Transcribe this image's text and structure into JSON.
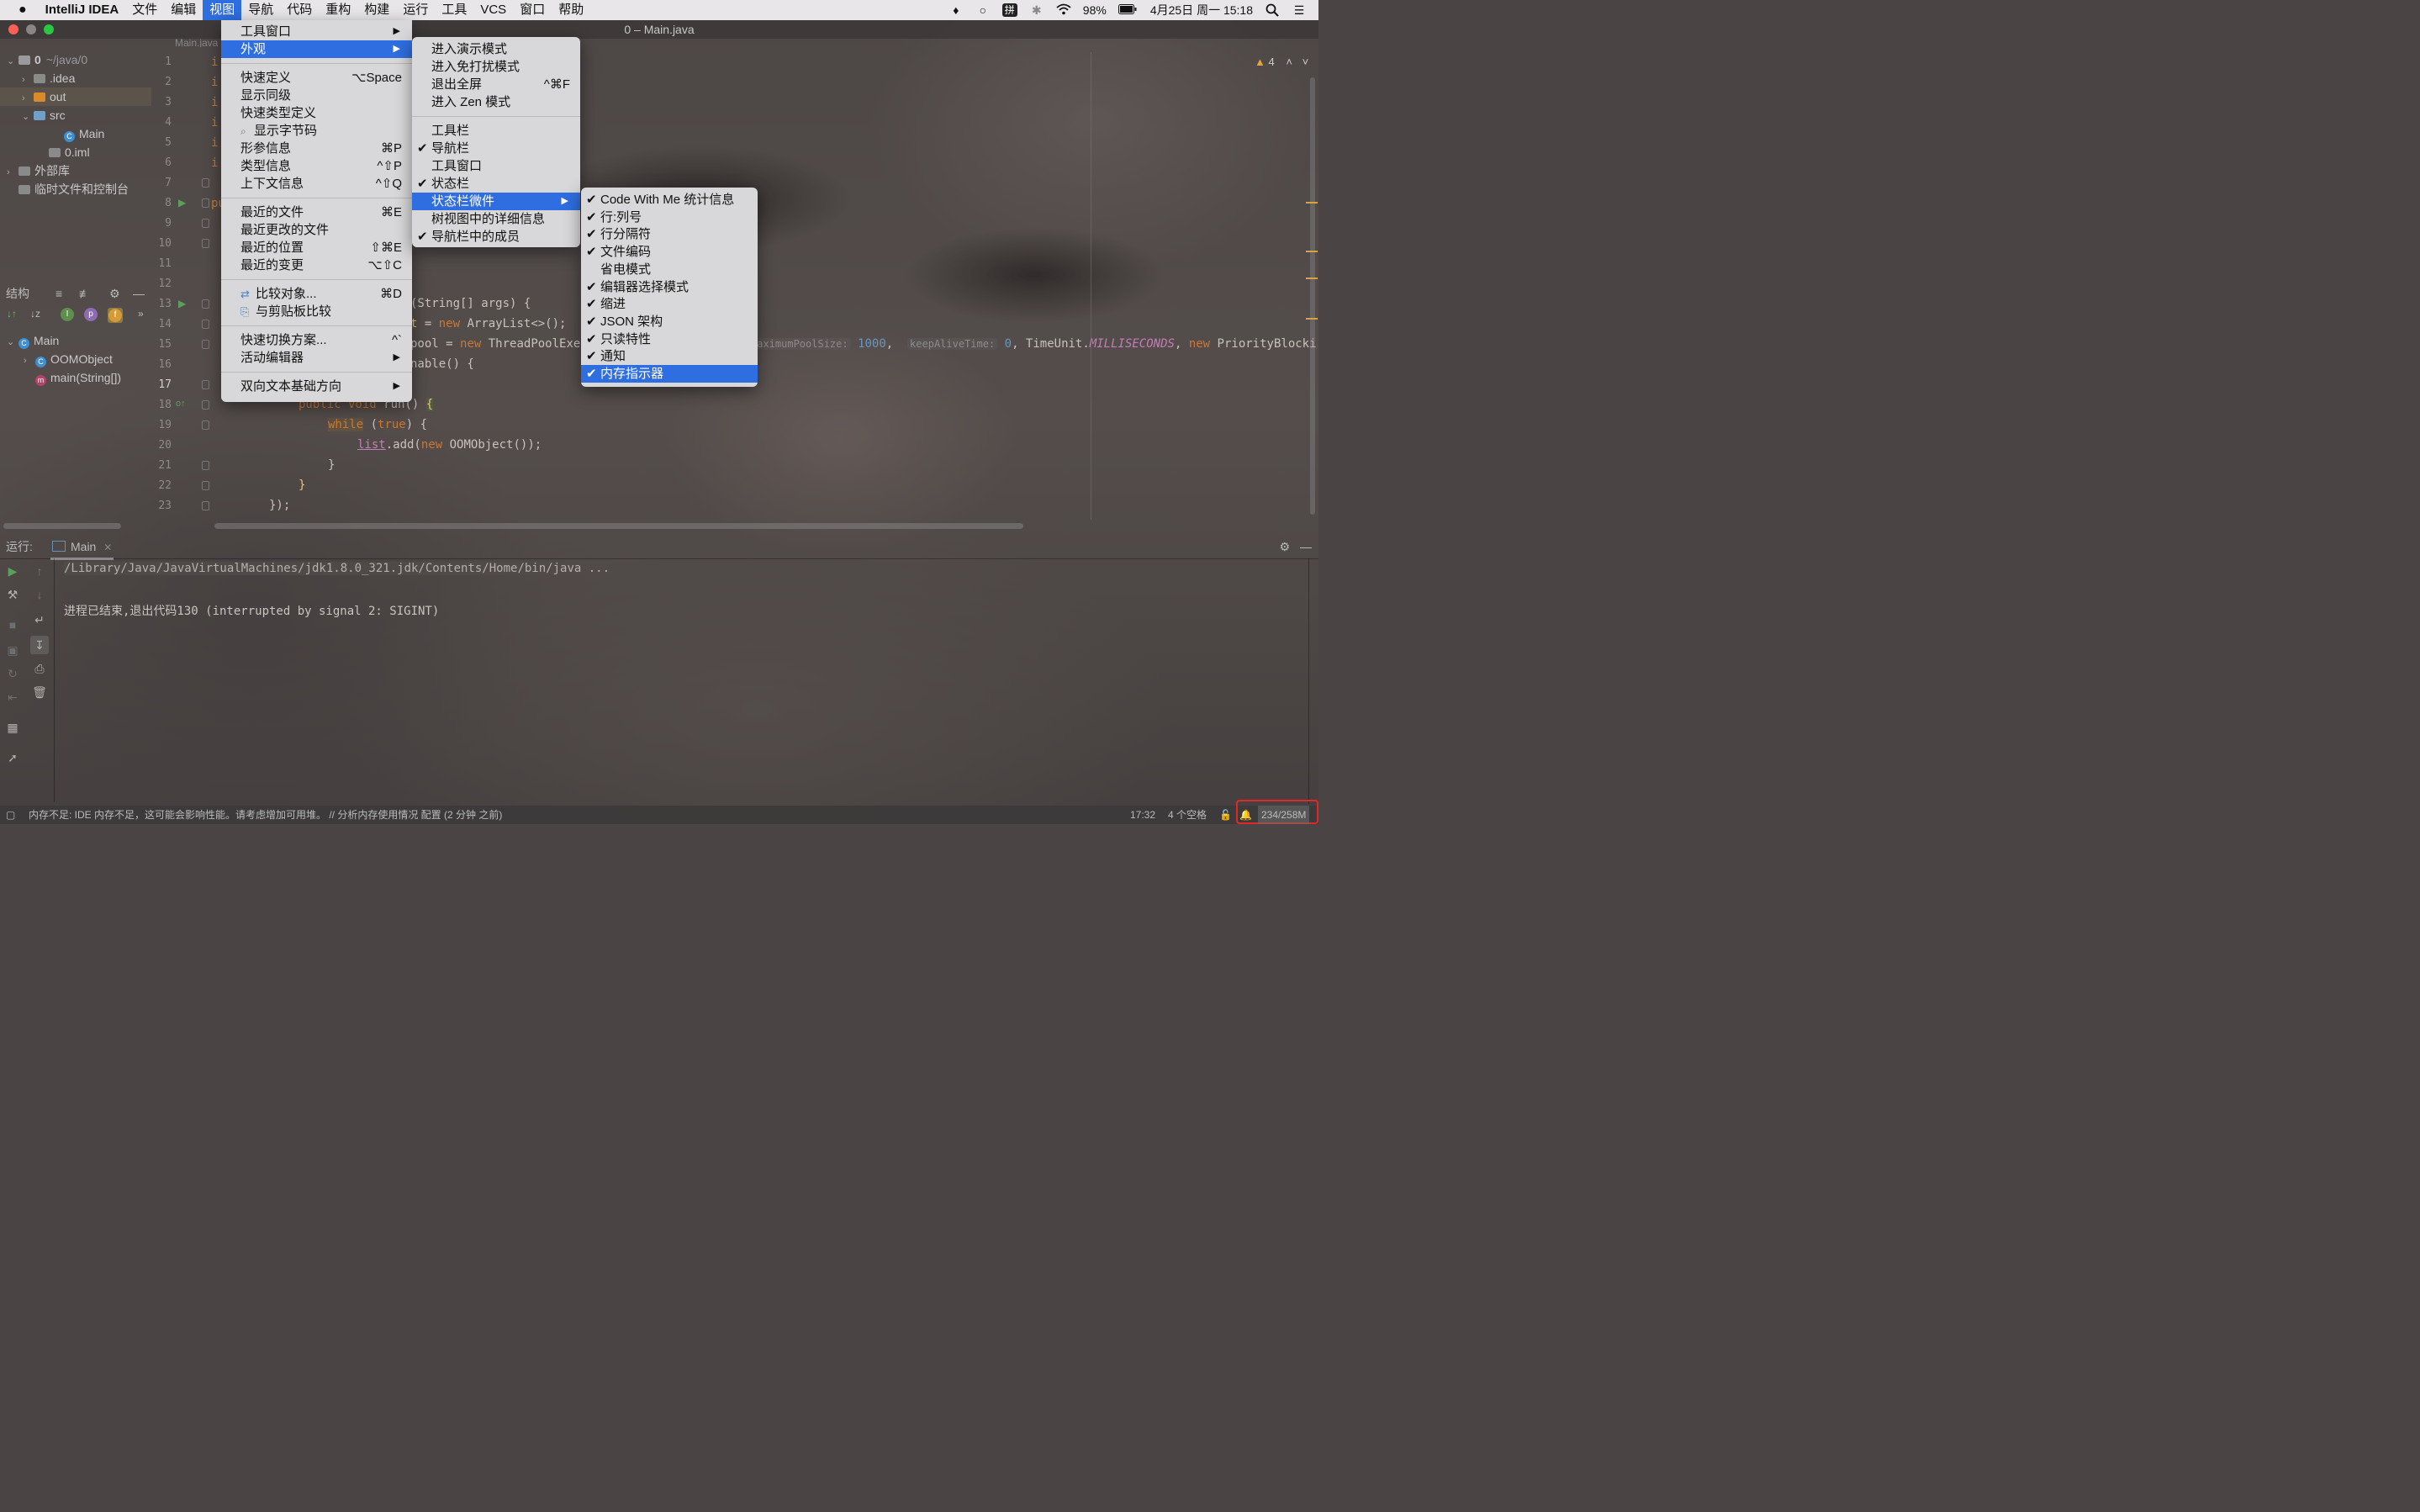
{
  "os_menubar": {
    "app_name": "IntelliJ IDEA",
    "items": [
      "文件",
      "编辑",
      "视图",
      "导航",
      "代码",
      "重构",
      "构建",
      "运行",
      "工具",
      "VCS",
      "窗口",
      "帮助"
    ],
    "active_index": 2,
    "battery": "98%",
    "datetime": "4月25日 周一  15:18",
    "input_method": "拼"
  },
  "window": {
    "title": "0 – Main.java",
    "tab_label": "Main.java"
  },
  "project_tree": [
    {
      "label": "0",
      "suffix": "~/java/0",
      "indent": 0,
      "arrow": "v",
      "icon": "folder-icon"
    },
    {
      "label": ".idea",
      "indent": 1,
      "arrow": ">",
      "icon": "folder-icon"
    },
    {
      "label": "out",
      "indent": 1,
      "arrow": ">",
      "icon": "folder-icon"
    },
    {
      "label": "src",
      "indent": 1,
      "arrow": "v",
      "icon": "folder-icon"
    },
    {
      "label": "Main",
      "indent": 3,
      "arrow": "",
      "icon": "class-icon"
    },
    {
      "label": "0.iml",
      "indent": 2,
      "arrow": "",
      "icon": "file-icon"
    },
    {
      "label": "外部库",
      "indent": 0,
      "arrow": ">",
      "icon": "library-icon"
    },
    {
      "label": "临时文件和控制台",
      "indent": 0,
      "arrow": "",
      "icon": "scratch-icon"
    }
  ],
  "structure": {
    "title": "结构",
    "items": [
      {
        "label": "Main",
        "indent": 0
      },
      {
        "label": "OOMObject",
        "indent": 1
      },
      {
        "label": "main(String[])",
        "indent": 1
      }
    ]
  },
  "editor": {
    "line_numbers": [
      "1",
      "2",
      "3",
      "4",
      "5",
      "6",
      "7",
      "8",
      "9",
      "10",
      "11",
      "12",
      "13",
      "14",
      "15",
      "16",
      "17",
      "18",
      "19",
      "20",
      "21",
      "22",
      "23"
    ],
    "warnings": "4",
    "lines": {
      "l12": "(String[] args) {",
      "l13a": "t",
      "l13b": " = ",
      "l13c": "new",
      "l13d": " ArrayList<>();",
      "l14a": "pool = ",
      "l14b": "new",
      "l14c": " ThreadPoolExe",
      "l14_hint1": "maximumPoolSize:",
      "l14_v1": "1000",
      "l14_hint2": "keepAliveTime:",
      "l14_v2": "0",
      "l14_rest1": ", TimeUnit.",
      "l14_rest2": "MILLISECONDS",
      "l14_rest3": ", ",
      "l14_rest4": "new",
      "l14_rest5": " PriorityBlocki",
      "l15": "nable() {",
      "l17a": "public void",
      "l17b": " run() ",
      "l17c": "{",
      "l18a": "while",
      "l18b": " (",
      "l18c": "true",
      "l18d": ") {",
      "l19a": "list",
      "l19b": ".add(",
      "l19c": "new",
      "l19d": " OOMObject());",
      "l20": "}",
      "l21": "}",
      "l22": "});",
      "left_fragments": [
        "i",
        "i",
        "i",
        "i",
        "i",
        "i",
        "pu"
      ]
    }
  },
  "view_menu": {
    "items": [
      {
        "label": "工具窗口",
        "shortcut": "",
        "submenu": true
      },
      {
        "label": "外观",
        "shortcut": "",
        "submenu": true,
        "highlighted": true
      },
      {
        "label": "快速定义",
        "shortcut": "⌥Space"
      },
      {
        "label": "显示同级",
        "shortcut": ""
      },
      {
        "label": "快速类型定义",
        "shortcut": ""
      },
      {
        "label": "显示字节码",
        "shortcut": ""
      },
      {
        "label": "形参信息",
        "shortcut": "⌘P"
      },
      {
        "label": "类型信息",
        "shortcut": "^⇧P"
      },
      {
        "label": "上下文信息",
        "shortcut": "^⇧Q"
      },
      {
        "label": "最近的文件",
        "shortcut": "⌘E"
      },
      {
        "label": "最近更改的文件",
        "shortcut": ""
      },
      {
        "label": "最近的位置",
        "shortcut": "⇧⌘E"
      },
      {
        "label": "最近的变更",
        "shortcut": "⌥⇧C"
      },
      {
        "label": "比较对象...",
        "shortcut": "⌘D"
      },
      {
        "label": "与剪贴板比较",
        "shortcut": ""
      },
      {
        "label": "快速切换方案...",
        "shortcut": "^`"
      },
      {
        "label": "活动编辑器",
        "shortcut": "",
        "submenu": true
      },
      {
        "label": "双向文本基础方向",
        "shortcut": "",
        "submenu": true
      }
    ]
  },
  "appearance_menu": {
    "items": [
      {
        "label": "进入演示模式",
        "checked": false
      },
      {
        "label": "进入免打扰模式",
        "checked": false
      },
      {
        "label": "退出全屏",
        "checked": false,
        "shortcut": "^⌘F"
      },
      {
        "label": "进入 Zen 模式",
        "checked": false
      },
      {
        "label": "工具栏",
        "checked": false
      },
      {
        "label": "导航栏",
        "checked": true
      },
      {
        "label": "工具窗口",
        "checked": false
      },
      {
        "label": "状态栏",
        "checked": true
      },
      {
        "label": "状态栏微件",
        "checked": false,
        "submenu": true,
        "highlighted": true
      },
      {
        "label": "树视图中的详细信息",
        "checked": false
      },
      {
        "label": "导航栏中的成员",
        "checked": true
      }
    ]
  },
  "widgets_menu": {
    "items": [
      {
        "label": "Code With Me 统计信息",
        "checked": true
      },
      {
        "label": "行:列号",
        "checked": true
      },
      {
        "label": "行分隔符",
        "checked": true
      },
      {
        "label": "文件编码",
        "checked": true
      },
      {
        "label": "省电模式",
        "checked": false
      },
      {
        "label": "编辑器选择模式",
        "checked": true
      },
      {
        "label": "缩进",
        "checked": true
      },
      {
        "label": "JSON 架构",
        "checked": true
      },
      {
        "label": "只读特性",
        "checked": true
      },
      {
        "label": "通知",
        "checked": true
      },
      {
        "label": "内存指示器",
        "checked": true,
        "highlighted": true
      }
    ]
  },
  "run_panel": {
    "label": "运行:",
    "tab": "Main",
    "console_lines": [
      "/Library/Java/JavaVirtualMachines/jdk1.8.0_321.jdk/Contents/Home/bin/java ...",
      "",
      "进程已结束,退出代码130 (interrupted by signal 2: SIGINT)"
    ]
  },
  "status_bar": {
    "message": "内存不足: IDE 内存不足，这可能会影响性能。请考虑增加可用堆。 // 分析内存使用情况   配置 (2 分钟 之前)",
    "position": "17:32",
    "indent": "4 个空格",
    "memory": "234/258M"
  },
  "colors": {
    "accent": "#2f6ee0",
    "highlight_box": "#e02828",
    "keyword": "#cc7832",
    "number": "#6897bb"
  }
}
